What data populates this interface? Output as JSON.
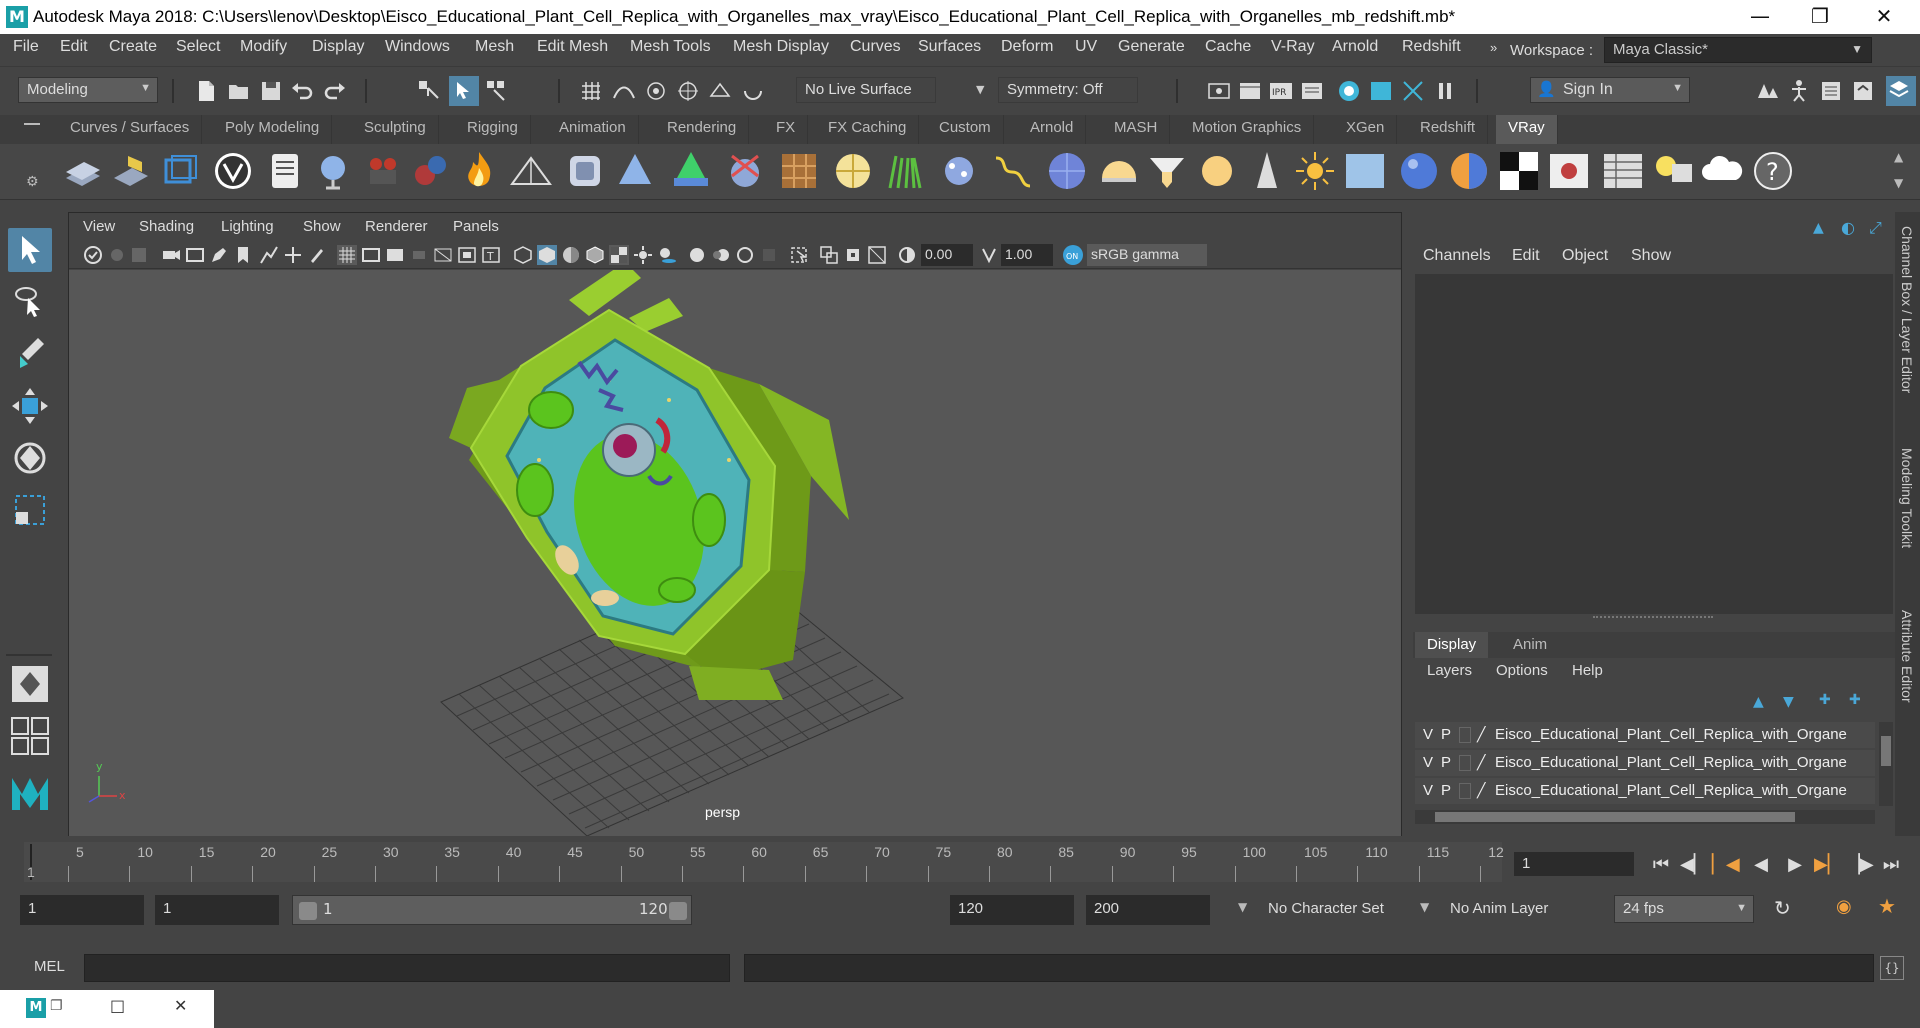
{
  "window": {
    "title": "Autodesk Maya 2018: C:\\Users\\lenov\\Desktop\\Eisco_Educational_Plant_Cell_Replica_with_Organelles_max_vray\\Eisco_Educational_Plant_Cell_Replica_with_Organelles_mb_redshift.mb*",
    "logo_letter": "M"
  },
  "menubar": {
    "items": [
      "File",
      "Edit",
      "Create",
      "Select",
      "Modify",
      "Display",
      "Windows",
      "Mesh",
      "Edit Mesh",
      "Mesh Tools",
      "Mesh Display",
      "Curves",
      "Surfaces",
      "Deform",
      "UV",
      "Generate",
      "Cache",
      "V-Ray",
      "Arnold",
      "Redshift"
    ],
    "workspace_label": "Workspace :",
    "workspace_value": "Maya Classic*"
  },
  "statusline": {
    "mode": "Modeling",
    "live_surface": "No Live Surface",
    "symmetry": "Symmetry: Off",
    "sign_in": "Sign In"
  },
  "shelf": {
    "tabs": [
      "Curves / Surfaces",
      "Poly Modeling",
      "Sculpting",
      "Rigging",
      "Animation",
      "Rendering",
      "FX",
      "FX Caching",
      "Custom",
      "Arnold",
      "MASH",
      "Motion Graphics",
      "XGen",
      "Redshift",
      "VRay"
    ],
    "active_tab": "VRay"
  },
  "viewport": {
    "menu": [
      "View",
      "Shading",
      "Lighting",
      "Show",
      "Renderer",
      "Panels"
    ],
    "exposure": "0.00",
    "gamma_value": "1.00",
    "color_space": "sRGB gamma",
    "camera": "persp"
  },
  "channelbox": {
    "menu": [
      "Channels",
      "Edit",
      "Object",
      "Show"
    ],
    "layer_tabs": [
      "Display",
      "Anim"
    ],
    "layer_menu": [
      "Layers",
      "Options",
      "Help"
    ],
    "layers": [
      {
        "v": "V",
        "p": "P",
        "name": "Eisco_Educational_Plant_Cell_Replica_with_Organe"
      },
      {
        "v": "V",
        "p": "P",
        "name": "Eisco_Educational_Plant_Cell_Replica_with_Organe"
      },
      {
        "v": "V",
        "p": "P",
        "name": "Eisco_Educational_Plant_Cell_Replica_with_Organe"
      }
    ],
    "side_tabs": [
      "Channel Box / Layer Editor",
      "Modeling Toolkit",
      "Attribute Editor"
    ]
  },
  "timeslider": {
    "ticks": [
      "5",
      "10",
      "15",
      "20",
      "25",
      "30",
      "35",
      "40",
      "45",
      "50",
      "55",
      "60",
      "65",
      "70",
      "75",
      "80",
      "85",
      "90",
      "95",
      "100",
      "105",
      "110",
      "115",
      "12"
    ],
    "start_label": "1",
    "current_frame": "1"
  },
  "rangeslider": {
    "start_frame": "1",
    "playback_start": "1",
    "range_start": "1",
    "range_end": "120",
    "playback_end": "120",
    "end_frame": "200",
    "character_set": "No Character Set",
    "anim_layer": "No Anim Layer",
    "fps": "24 fps"
  },
  "cmdline": {
    "label": "MEL"
  },
  "axis": {
    "x": "x",
    "y": "y"
  }
}
